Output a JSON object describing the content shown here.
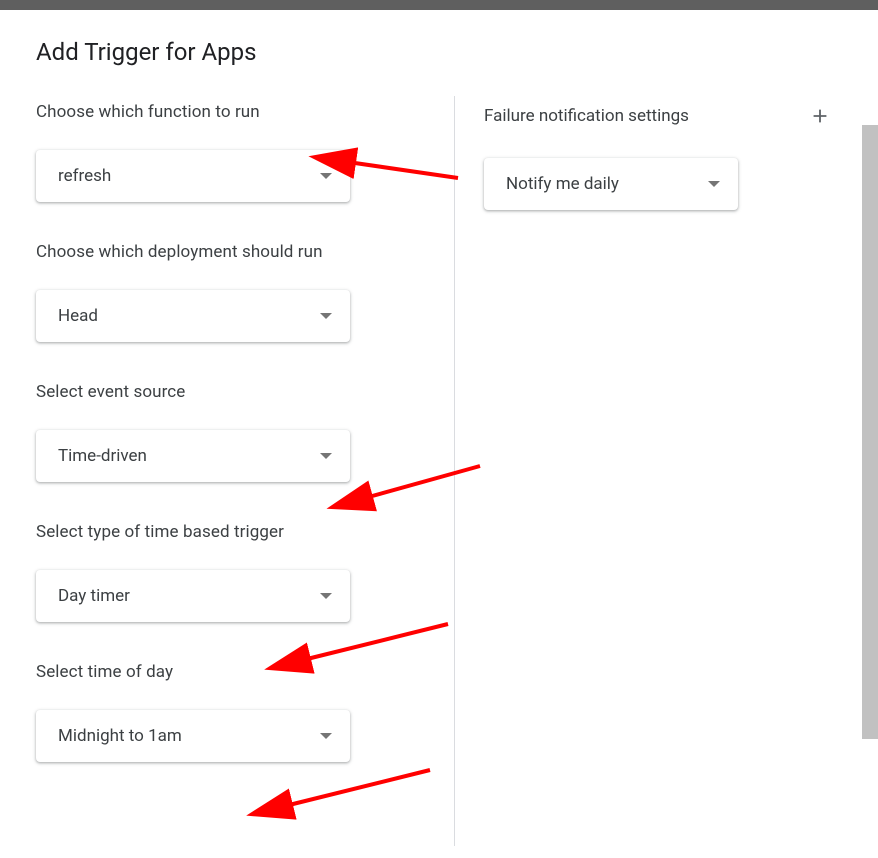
{
  "dialog_title": "Add Trigger for Apps",
  "left": {
    "function": {
      "label": "Choose which function to run",
      "value": "refresh"
    },
    "deployment": {
      "label": "Choose which deployment should run",
      "value": "Head"
    },
    "event_source": {
      "label": "Select event source",
      "value": "Time-driven"
    },
    "trigger_type": {
      "label": "Select type of time based trigger",
      "value": "Day timer"
    },
    "time_of_day": {
      "label": "Select time of day",
      "value": "Midnight to 1am"
    }
  },
  "right": {
    "failure": {
      "label": "Failure notification settings",
      "value": "Notify me daily"
    }
  }
}
